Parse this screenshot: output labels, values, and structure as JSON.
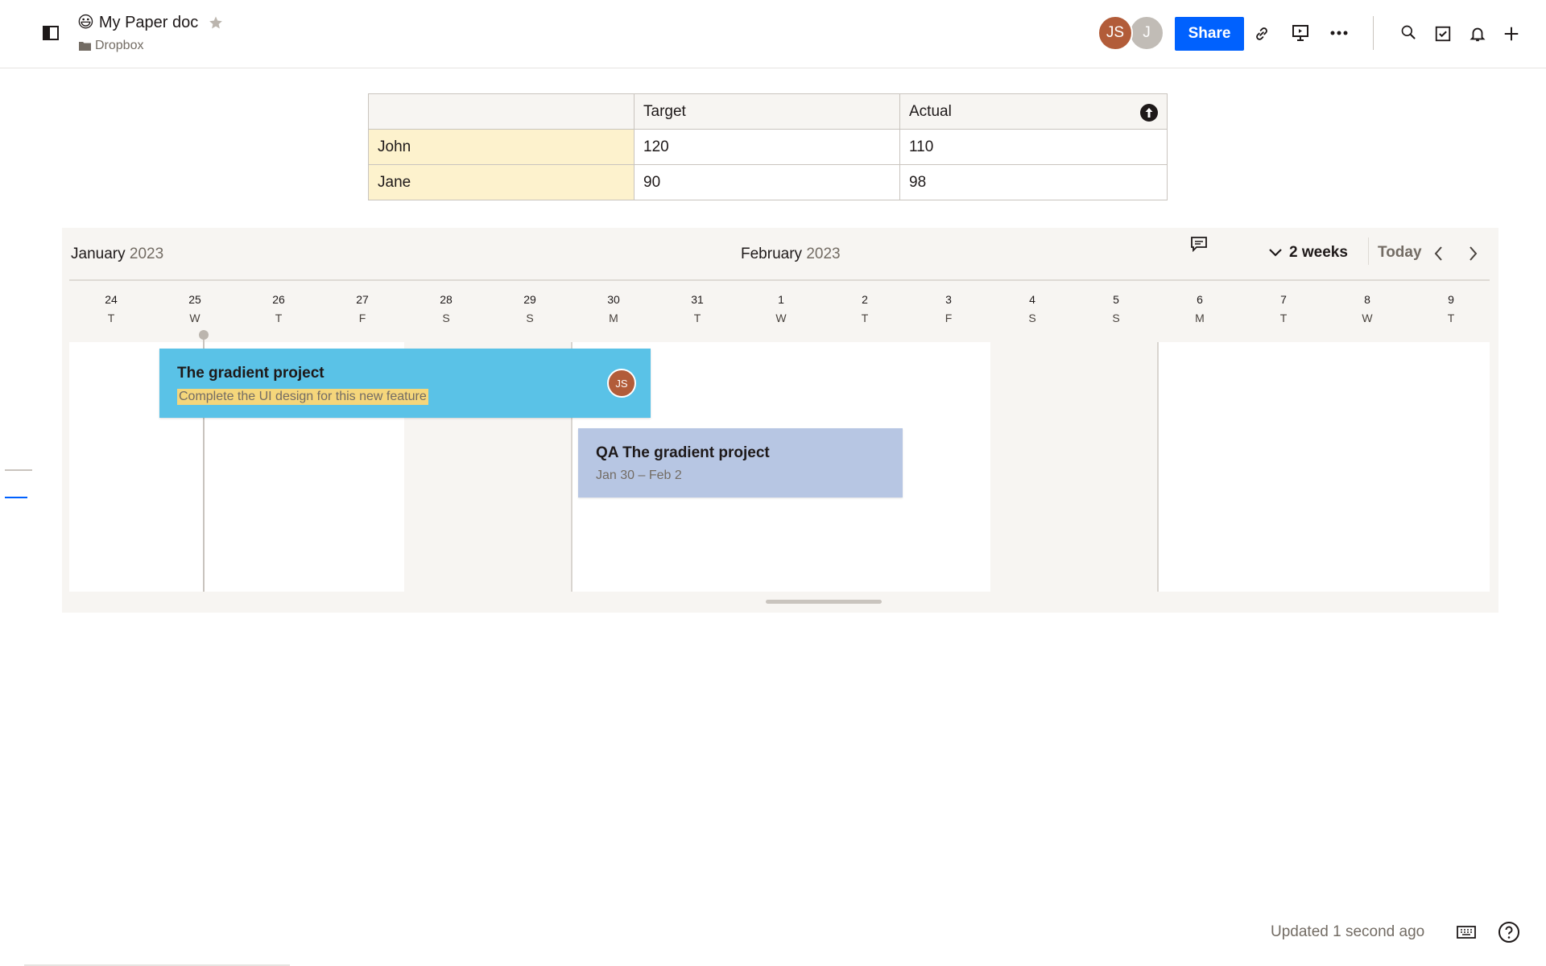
{
  "header": {
    "emoji": "😃",
    "title": "My Paper doc",
    "breadcrumb": "Dropbox",
    "share_label": "Share",
    "avatars": [
      {
        "initials": "JS",
        "color": "#b25c39"
      },
      {
        "initials": "J",
        "color": "#c1bcb6"
      }
    ]
  },
  "table": {
    "headers": [
      "",
      "Target",
      "Actual"
    ],
    "rows": [
      {
        "name": "John",
        "target": "120",
        "actual": "110"
      },
      {
        "name": "Jane",
        "target": "90",
        "actual": "98"
      }
    ]
  },
  "timeline": {
    "month_left": {
      "month": "January",
      "year": "2023"
    },
    "month_center": {
      "month": "February",
      "year": "2023"
    },
    "range_label": "2 weeks",
    "today_label": "Today",
    "days": [
      {
        "num": "24",
        "dow": "T"
      },
      {
        "num": "25",
        "dow": "W"
      },
      {
        "num": "26",
        "dow": "T"
      },
      {
        "num": "27",
        "dow": "F"
      },
      {
        "num": "28",
        "dow": "S"
      },
      {
        "num": "29",
        "dow": "S"
      },
      {
        "num": "30",
        "dow": "M"
      },
      {
        "num": "31",
        "dow": "T"
      },
      {
        "num": "1",
        "dow": "W"
      },
      {
        "num": "2",
        "dow": "T"
      },
      {
        "num": "3",
        "dow": "F"
      },
      {
        "num": "4",
        "dow": "S"
      },
      {
        "num": "5",
        "dow": "S"
      },
      {
        "num": "6",
        "dow": "M"
      },
      {
        "num": "7",
        "dow": "T"
      },
      {
        "num": "8",
        "dow": "W"
      },
      {
        "num": "9",
        "dow": "T"
      }
    ],
    "tasks": [
      {
        "title": "The gradient project",
        "description": "Complete the UI design for this new feature",
        "assignee": "JS",
        "color": "#5ac2e7"
      },
      {
        "title": "QA The gradient project",
        "dates": "Jan 30 – Feb 2",
        "color": "#b7c6e3"
      }
    ]
  },
  "footer": {
    "updated": "Updated 1 second ago"
  },
  "colors": {
    "accent": "#0061fe",
    "highlight": "#f5d67b",
    "name_cell": "#fdf2cd"
  }
}
